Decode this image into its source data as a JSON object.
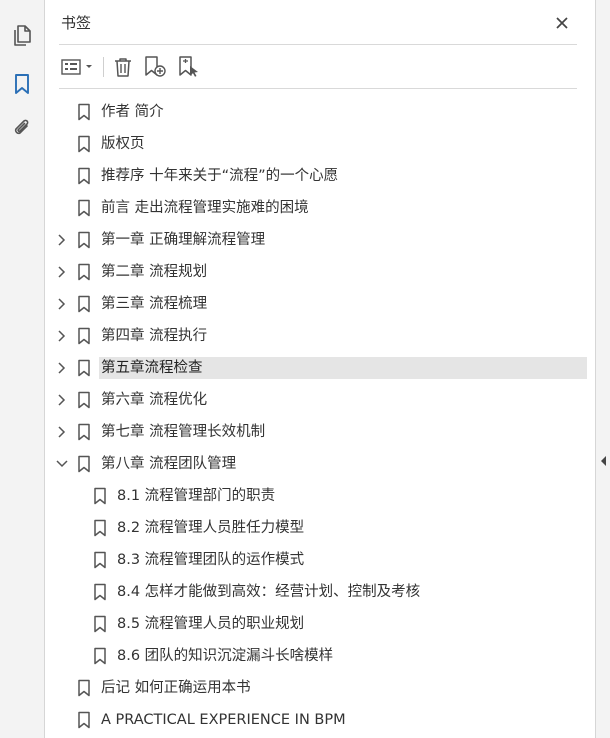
{
  "panel": {
    "title": "书签"
  },
  "rail": {
    "icons": [
      "pages-icon",
      "bookmarks-icon",
      "attachments-icon"
    ]
  },
  "toolbar": {
    "icons": [
      "options-menu-icon",
      "delete-bookmark-icon",
      "new-bookmark-icon",
      "bookmark-from-structure-icon"
    ]
  },
  "tree": {
    "items": [
      {
        "label": "作者 简介",
        "level": 0,
        "chevron": "none"
      },
      {
        "label": "版权页",
        "level": 0,
        "chevron": "none"
      },
      {
        "label": "推荐序 十年来关于“流程”的一个心愿",
        "level": 0,
        "chevron": "none"
      },
      {
        "label": "前言 走出流程管理实施难的困境",
        "level": 0,
        "chevron": "none"
      },
      {
        "label": "第一章 正确理解流程管理",
        "level": 0,
        "chevron": "collapsed"
      },
      {
        "label": "第二章 流程规划",
        "level": 0,
        "chevron": "collapsed"
      },
      {
        "label": "第三章 流程梳理",
        "level": 0,
        "chevron": "collapsed"
      },
      {
        "label": "第四章 流程执行",
        "level": 0,
        "chevron": "collapsed"
      },
      {
        "label": "第五章流程检查",
        "level": 0,
        "chevron": "collapsed",
        "selected": true
      },
      {
        "label": "第六章 流程优化",
        "level": 0,
        "chevron": "collapsed"
      },
      {
        "label": "第七章 流程管理长效机制",
        "level": 0,
        "chevron": "collapsed"
      },
      {
        "label": "第八章 流程团队管理",
        "level": 0,
        "chevron": "expanded"
      },
      {
        "label": "8.1 流程管理部门的职责",
        "level": 1,
        "chevron": "none"
      },
      {
        "label": "8.2 流程管理人员胜任力模型",
        "level": 1,
        "chevron": "none"
      },
      {
        "label": "8.3 流程管理团队的运作模式",
        "level": 1,
        "chevron": "none"
      },
      {
        "label": "8.4 怎样才能做到高效：经营计划、控制及考核",
        "level": 1,
        "chevron": "none"
      },
      {
        "label": "8.5 流程管理人员的职业规划",
        "level": 1,
        "chevron": "none"
      },
      {
        "label": "8.6 团队的知识沉淀漏斗长啥模样",
        "level": 1,
        "chevron": "none"
      },
      {
        "label": "后记 如何正确运用本书",
        "level": 0,
        "chevron": "none"
      },
      {
        "label": "A PRACTICAL EXPERIENCE IN BPM",
        "level": 0,
        "chevron": "none"
      }
    ]
  },
  "colors": {
    "icon": "#555555",
    "accent": "#2a6fb6",
    "selected_bg": "#e5e5e5"
  }
}
